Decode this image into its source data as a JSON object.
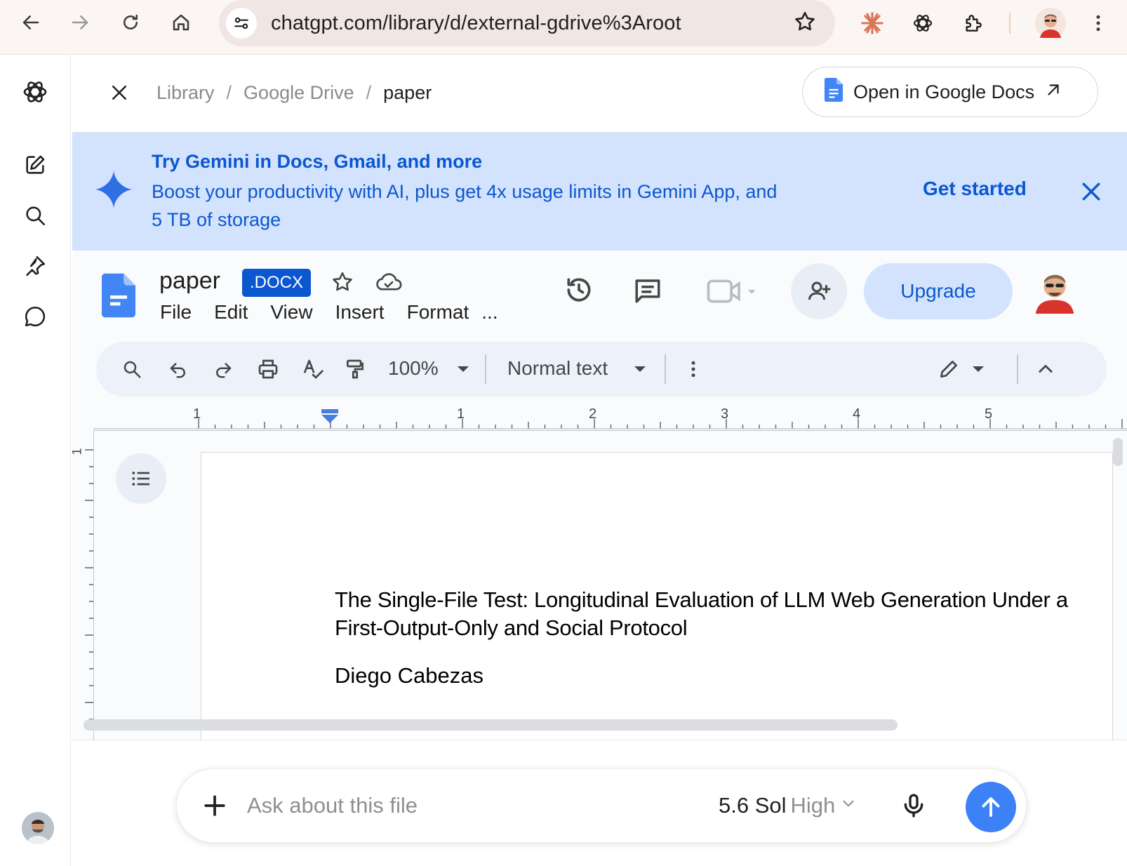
{
  "browser": {
    "url": "chatgpt.com/library/d/external-gdrive%3Aroot"
  },
  "breadcrumb": {
    "items": [
      "Library",
      "Google Drive",
      "paper"
    ],
    "separator": "/"
  },
  "open_button": {
    "label": "Open in Google Docs"
  },
  "gemini_banner": {
    "title": "Try Gemini in Docs, Gmail, and more",
    "body": "Boost your productivity with AI, plus get 4x usage limits in Gemini App, and 5 TB of storage",
    "cta": "Get started"
  },
  "docs": {
    "title": "paper",
    "badge": ".DOCX",
    "menu": [
      "File",
      "Edit",
      "View",
      "Insert",
      "Format",
      "..."
    ],
    "upgrade_label": "Upgrade",
    "zoom": "100%",
    "style": "Normal text",
    "ruler_labels": [
      "1",
      "1",
      "2",
      "3",
      "4",
      "5"
    ],
    "vruler_label": "1"
  },
  "document": {
    "heading": "The Single-File Test: Longitudinal Evaluation of LLM Web Generation Under a First-Output-Only and Social Protocol",
    "author": "Diego Cabezas"
  },
  "ask": {
    "placeholder": "Ask about this file",
    "model_name": "5.6 Sol",
    "model_effort": "High"
  },
  "colors": {
    "accent_blue": "#0b57d0",
    "banner_bg": "#d3e3fd",
    "send_button": "#3c82f6"
  }
}
